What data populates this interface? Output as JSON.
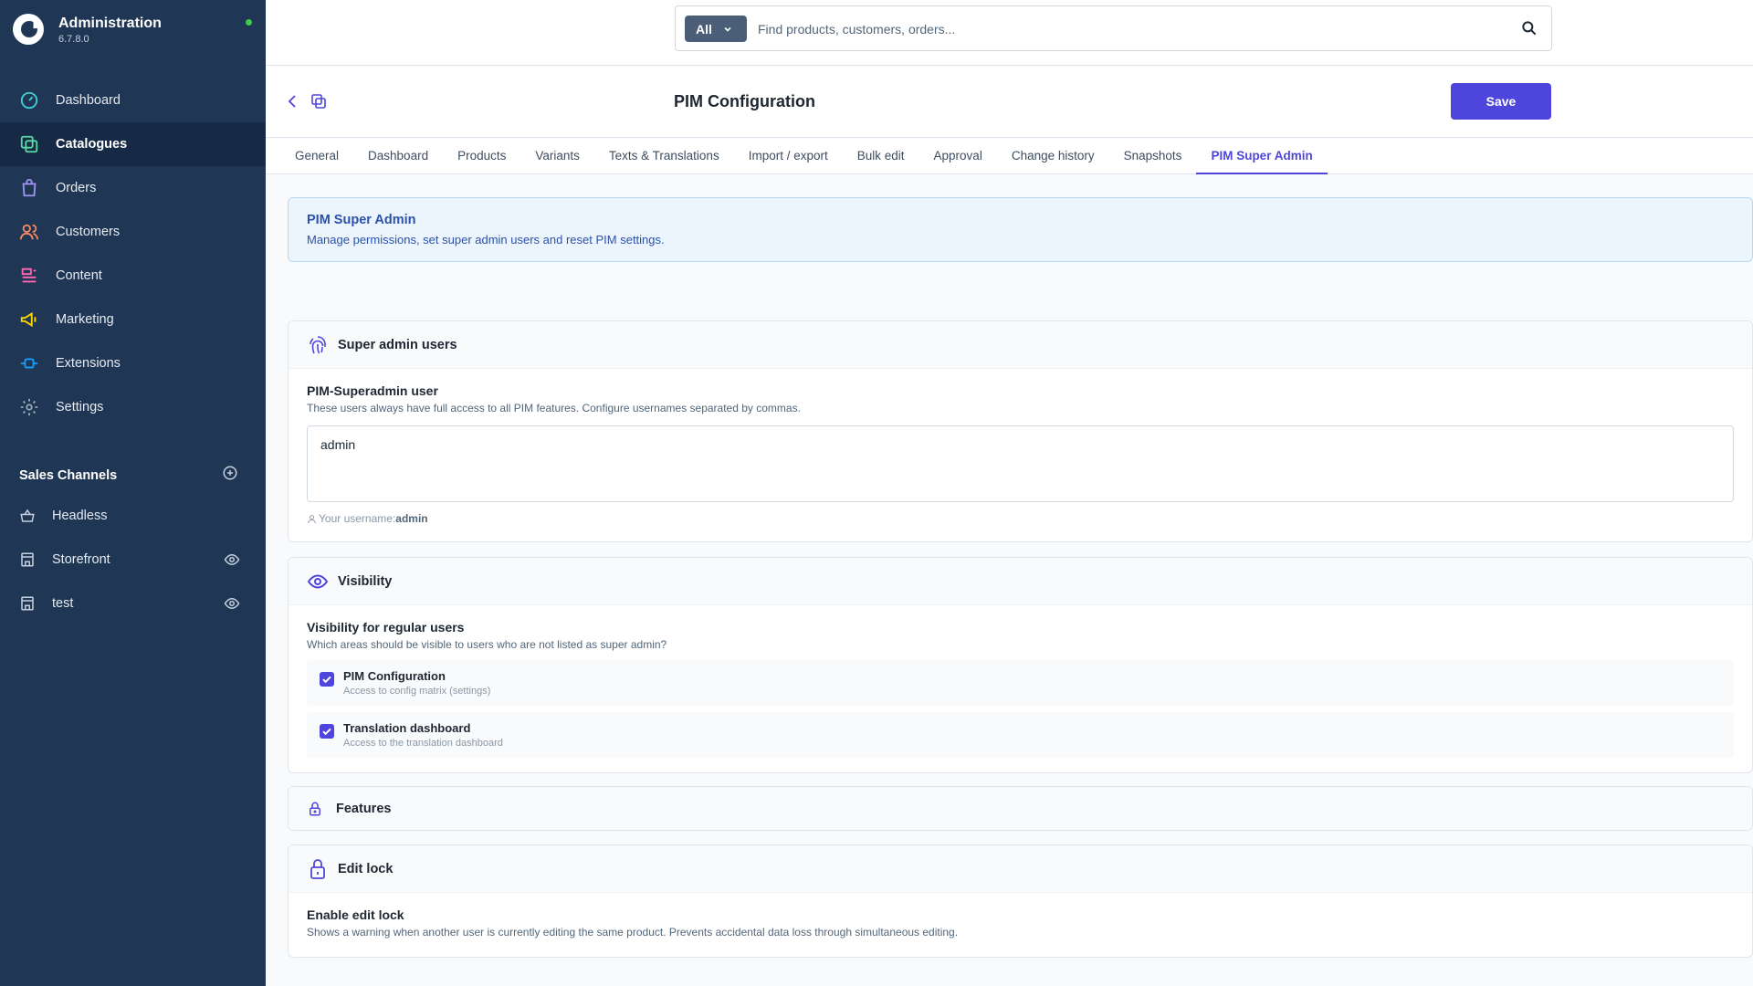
{
  "app": {
    "title": "Administration",
    "version": "6.7.8.0"
  },
  "nav": {
    "items": [
      {
        "label": "Dashboard",
        "icon": "dashboard-icon",
        "color": "#3fd0d6"
      },
      {
        "label": "Catalogues",
        "icon": "catalogues-icon",
        "color": "#57d9a3"
      },
      {
        "label": "Orders",
        "icon": "orders-icon",
        "color": "#a092f0"
      },
      {
        "label": "Customers",
        "icon": "customers-icon",
        "color": "#f88962"
      },
      {
        "label": "Content",
        "icon": "content-icon",
        "color": "#ff68b4"
      },
      {
        "label": "Marketing",
        "icon": "marketing-icon",
        "color": "#ffd700"
      },
      {
        "label": "Extensions",
        "icon": "extensions-icon",
        "color": "#189eff"
      },
      {
        "label": "Settings",
        "icon": "settings-icon",
        "color": "#9aa8b5"
      }
    ]
  },
  "sales_channels": {
    "title": "Sales Channels",
    "items": [
      {
        "label": "Headless"
      },
      {
        "label": "Storefront"
      },
      {
        "label": "test"
      }
    ]
  },
  "search": {
    "type": "All",
    "placeholder": "Find products, customers, orders..."
  },
  "page": {
    "title": "PIM Configuration",
    "save_label": "Save"
  },
  "tabs": [
    {
      "label": "General"
    },
    {
      "label": "Dashboard"
    },
    {
      "label": "Products"
    },
    {
      "label": "Variants"
    },
    {
      "label": "Texts & Translations"
    },
    {
      "label": "Import / export"
    },
    {
      "label": "Bulk edit"
    },
    {
      "label": "Approval"
    },
    {
      "label": "Change history"
    },
    {
      "label": "Snapshots"
    },
    {
      "label": "PIM Super Admin"
    }
  ],
  "info": {
    "title": "PIM Super Admin",
    "text": "Manage permissions, set super admin users and reset PIM settings."
  },
  "super_admin": {
    "title": "Super admin users",
    "field_label": "PIM-Superadmin user",
    "help": "These users always have full access to all PIM features. Configure usernames separated by commas.",
    "value": "admin",
    "hint_prefix": "Your username:",
    "hint_user": "admin"
  },
  "visibility": {
    "title": "Visibility",
    "field_label": "Visibility for regular users",
    "help": "Which areas should be visible to users who are not listed as super admin?",
    "options": [
      {
        "label": "PIM Configuration",
        "sub": "Access to config matrix (settings)"
      },
      {
        "label": "Translation dashboard",
        "sub": "Access to the translation dashboard"
      }
    ]
  },
  "features": {
    "title": "Features"
  },
  "edit_lock": {
    "title": "Edit lock",
    "field_label": "Enable edit lock",
    "help": "Shows a warning when another user is currently editing the same product. Prevents accidental data loss through simultaneous editing."
  },
  "colors": {
    "sidebar": "#1f3655",
    "accent": "#4e46dc",
    "info_bg": "#ecf5fd",
    "status": "#37d046"
  }
}
